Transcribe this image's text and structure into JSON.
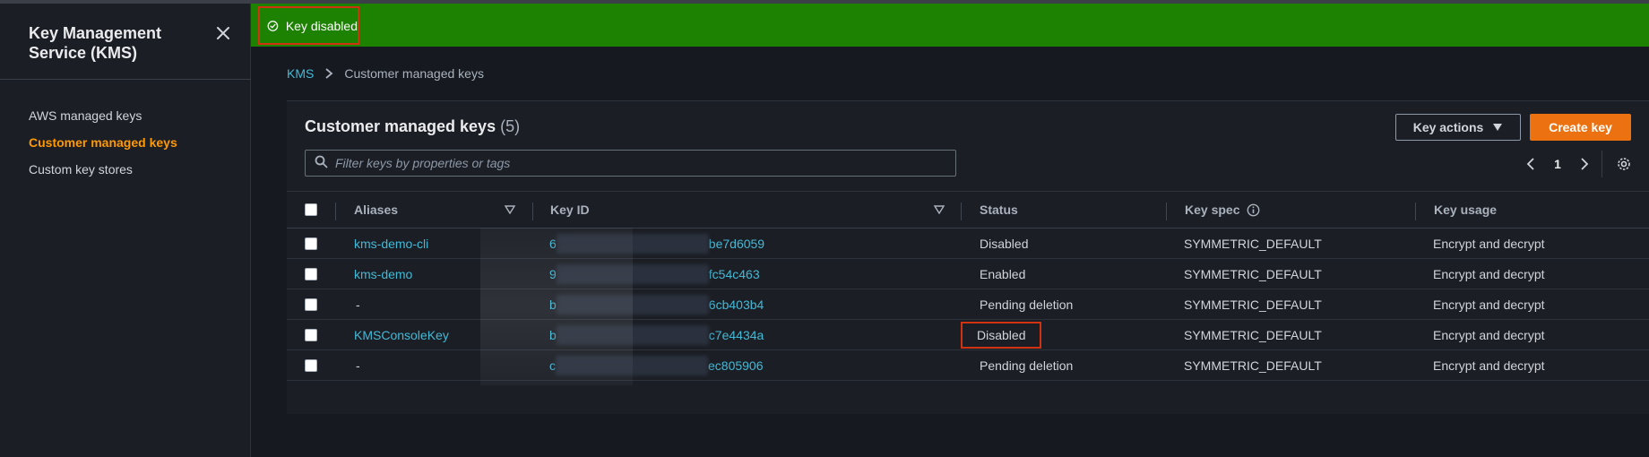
{
  "sidebar": {
    "title": "Key Management Service (KMS)",
    "items": [
      {
        "label": "AWS managed keys",
        "active": false
      },
      {
        "label": "Customer managed keys",
        "active": true
      },
      {
        "label": "Custom key stores",
        "active": false
      }
    ]
  },
  "flash": {
    "message": "Key disabled",
    "icon": "check-circle-icon"
  },
  "breadcrumb": {
    "root": "KMS",
    "current": "Customer managed keys"
  },
  "panel": {
    "title": "Customer managed keys",
    "count": "(5)",
    "key_actions_label": "Key actions",
    "create_key_label": "Create key",
    "search_placeholder": "Filter keys by properties or tags",
    "page": "1"
  },
  "table": {
    "columns": {
      "aliases": "Aliases",
      "key_id": "Key ID",
      "status": "Status",
      "key_spec": "Key spec",
      "key_usage": "Key usage"
    },
    "rows": [
      {
        "alias": "kms-demo-cli",
        "key_id_prefix": "6",
        "key_id_suffix": "be7d6059",
        "status": "Disabled",
        "key_spec": "SYMMETRIC_DEFAULT",
        "key_usage": "Encrypt and decrypt"
      },
      {
        "alias": "kms-demo",
        "key_id_prefix": "9",
        "key_id_suffix": "fc54c463",
        "status": "Enabled",
        "key_spec": "SYMMETRIC_DEFAULT",
        "key_usage": "Encrypt and decrypt"
      },
      {
        "alias": "-",
        "key_id_prefix": "b",
        "key_id_suffix": "6cb403b4",
        "status": "Pending deletion",
        "key_spec": "SYMMETRIC_DEFAULT",
        "key_usage": "Encrypt and decrypt"
      },
      {
        "alias": "KMSConsoleKey",
        "key_id_prefix": "b",
        "key_id_suffix": "c7e4434a",
        "status": "Disabled",
        "key_spec": "SYMMETRIC_DEFAULT",
        "key_usage": "Encrypt and decrypt"
      },
      {
        "alias": "-",
        "key_id_prefix": "c",
        "key_id_suffix": "ec805906",
        "status": "Pending deletion",
        "key_spec": "SYMMETRIC_DEFAULT",
        "key_usage": "Encrypt and decrypt"
      }
    ]
  },
  "colors": {
    "accent": "#ff9900",
    "success": "#1d8102",
    "primary_button": "#ec7211",
    "link": "#44b9d6",
    "highlight": "#d13212"
  }
}
